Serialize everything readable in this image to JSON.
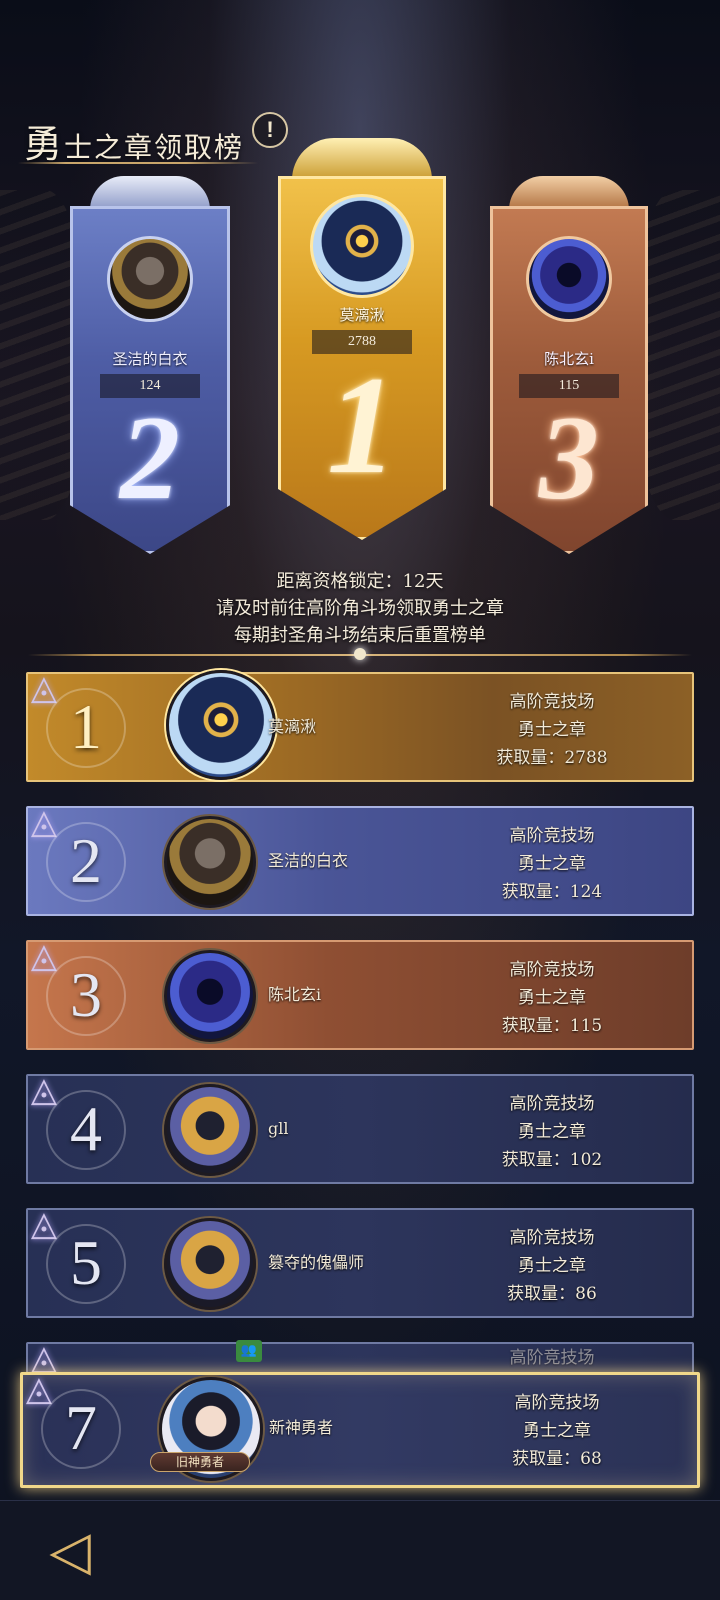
{
  "header": {
    "title_first": "勇",
    "title_rest": "士之章领取榜",
    "info_icon": "info-icon"
  },
  "podium": [
    {
      "rank": "2",
      "name": "圣洁的白衣",
      "score": "124"
    },
    {
      "rank": "1",
      "name": "莫漓湫",
      "score": "2788"
    },
    {
      "rank": "3",
      "name": "陈北玄i",
      "score": "115"
    }
  ],
  "info": {
    "line1": "距离资格锁定：12天",
    "line2": "请及时前往高阶角斗场领取勇士之章",
    "line3": "每期封圣角斗场结束后重置榜单"
  },
  "rows": [
    {
      "rank": "1",
      "name": "莫漓湫",
      "arena": "高阶竞技场",
      "item": "勇士之章",
      "amount": "获取量：2788"
    },
    {
      "rank": "2",
      "name": "圣洁的白衣",
      "arena": "高阶竞技场",
      "item": "勇士之章",
      "amount": "获取量：124"
    },
    {
      "rank": "3",
      "name": "陈北玄i",
      "arena": "高阶竞技场",
      "item": "勇士之章",
      "amount": "获取量：115"
    },
    {
      "rank": "4",
      "name": "gll",
      "arena": "高阶竞技场",
      "item": "勇士之章",
      "amount": "获取量：102"
    },
    {
      "rank": "5",
      "name": "篡夺的傀儡师",
      "arena": "高阶竞技场",
      "item": "勇士之章",
      "amount": "获取量：86"
    }
  ],
  "self_row": {
    "rank": "7",
    "name": "新神勇者",
    "arena": "高阶竞技场",
    "item": "勇士之章",
    "amount": "获取量：68",
    "badge": "旧神勇者"
  },
  "partial_row": {
    "arena": "高阶竞技场"
  },
  "icons": {
    "back": "back-arrow-icon",
    "rank_mark": "triangle-rank-icon",
    "friend": "friend-icon"
  },
  "colors": {
    "gold": "#c28a2a",
    "silver": "#6b79bf",
    "bronze": "#c5764c",
    "default": "#273055",
    "highlight": "#f1d88a"
  }
}
